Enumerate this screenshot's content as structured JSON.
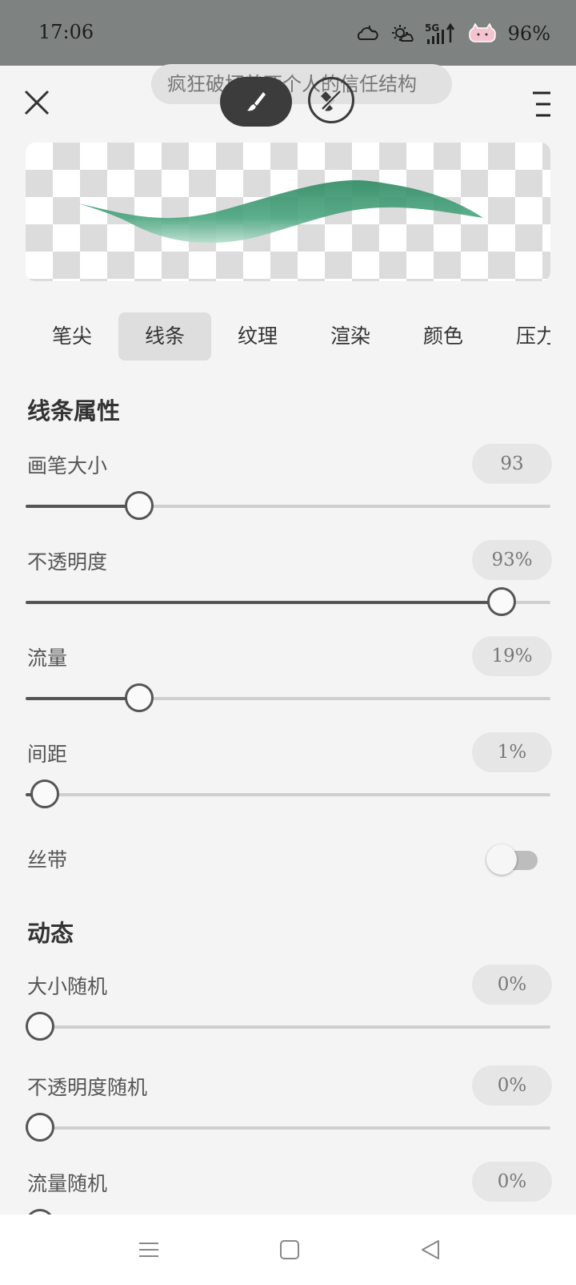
{
  "status_bar": {
    "time": "17:06",
    "network": "5G",
    "battery": "96%",
    "icons": [
      "cloud-moon-icon",
      "weather-icon",
      "signal-5g-icon",
      "battery-cat-icon"
    ]
  },
  "header": {
    "title": "疯狂破坏着两个人的信任结构",
    "close_icon": "close-icon",
    "menu_icon": "menu-icon",
    "brush_tool_icon": "brush-icon",
    "eraser_tool_icon": "eraser-icon"
  },
  "preview": {
    "stroke_color": "#2e8a62"
  },
  "tabs": [
    {
      "label": "笔尖",
      "active": false
    },
    {
      "label": "线条",
      "active": true
    },
    {
      "label": "纹理",
      "active": false
    },
    {
      "label": "渲染",
      "active": false
    },
    {
      "label": "颜色",
      "active": false
    },
    {
      "label": "压力",
      "active": false
    }
  ],
  "line_properties": {
    "title": "线条属性",
    "brush_size": {
      "label": "画笔大小",
      "value": "93",
      "fraction": 0.2
    },
    "opacity": {
      "label": "不透明度",
      "value": "93%",
      "fraction": 0.93
    },
    "flow": {
      "label": "流量",
      "value": "19%",
      "fraction": 0.2
    },
    "spacing": {
      "label": "间距",
      "value": "1%",
      "fraction": 0.01
    },
    "ribbon": {
      "label": "丝带",
      "enabled": false
    }
  },
  "dynamics": {
    "title": "动态",
    "size_random": {
      "label": "大小随机",
      "value": "0%",
      "fraction": 0
    },
    "opacity_random": {
      "label": "不透明度随机",
      "value": "0%",
      "fraction": 0
    },
    "flow_random": {
      "label": "流量随机",
      "value": "0%",
      "fraction": 0
    }
  },
  "nav_bar": {
    "icons": [
      "menu-lines-icon",
      "home-square-icon",
      "back-triangle-icon"
    ]
  },
  "colors": {
    "accent_dark": "#3c3c3c",
    "brush_green": "#2e8a62",
    "status_bar": "#7e8382"
  }
}
